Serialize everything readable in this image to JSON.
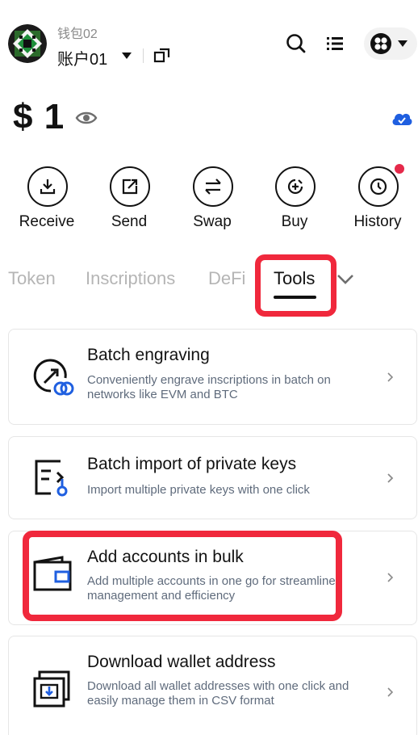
{
  "header": {
    "wallet_name": "钱包02",
    "account_name": "账户01"
  },
  "balance": {
    "amount": "$ 1"
  },
  "actions": [
    {
      "label": "Receive",
      "icon": "download-icon"
    },
    {
      "label": "Send",
      "icon": "send-icon"
    },
    {
      "label": "Swap",
      "icon": "swap-icon"
    },
    {
      "label": "Buy",
      "icon": "buy-icon"
    },
    {
      "label": "History",
      "icon": "clock-icon"
    }
  ],
  "tabs": [
    {
      "label": "Token",
      "active": false
    },
    {
      "label": "Inscriptions",
      "active": false
    },
    {
      "label": "DeFi",
      "active": false
    },
    {
      "label": "Tools",
      "active": true
    }
  ],
  "tools": [
    {
      "title": "Batch engraving",
      "description": "Conveniently engrave inscriptions in batch on networks like EVM and BTC",
      "icon": "engrave-icon"
    },
    {
      "title": "Batch import of private keys",
      "description": "Import multiple private keys with one click",
      "icon": "import-keys-icon"
    },
    {
      "title": "Add accounts in bulk",
      "description": "Add multiple accounts in one go for streamlined management and efficiency",
      "icon": "wallet-icon"
    },
    {
      "title": "Download wallet address",
      "description": "Download all wallet addresses with one click and easily manage them in CSV format",
      "icon": "download-address-icon"
    }
  ],
  "colors": {
    "highlight": "#f0283c",
    "badge": "#e5294a",
    "cloud": "#1f5fe0",
    "tool_accent": "#1f5fe0"
  }
}
